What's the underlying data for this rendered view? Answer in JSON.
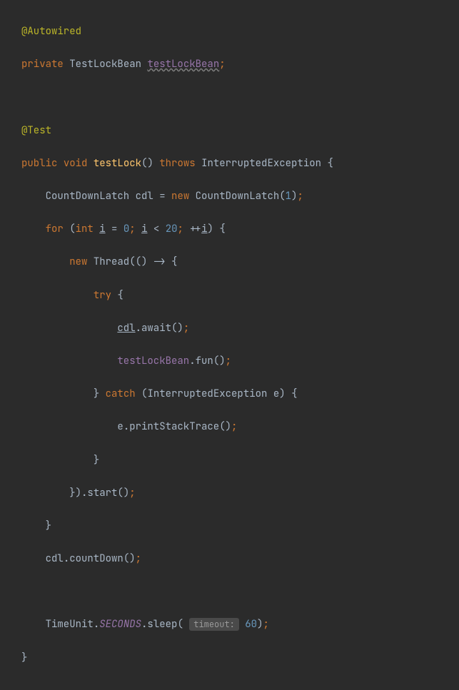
{
  "code": {
    "annotation_autowired": "@Autowired",
    "kw_private": "private",
    "type_testlockbean": "TestLockBean",
    "field_testlockbean": "testLockBean",
    "semi": ";",
    "annotation_test": "@Test",
    "kw_public": "public",
    "kw_void": "void",
    "method_testlock": "testLock",
    "kw_throws": "throws",
    "type_interruptedexception": "InterruptedException",
    "lbrace": "{",
    "rbrace": "}",
    "type_countdownlatch": "CountDownLatch",
    "var_cdl": "cdl",
    "op_assign": "=",
    "kw_new": "new",
    "num_1": "1",
    "kw_for": "for",
    "kw_int": "int",
    "var_i": "i",
    "num_0": "0",
    "op_lt": "<",
    "num_20": "20",
    "op_preinc": "++",
    "type_thread": "Thread",
    "lambda": "() ->",
    "kw_try": "try",
    "method_await": ".await",
    "method_fun": ".fun",
    "kw_catch": "catch",
    "var_e": "e",
    "method_printstacktrace": ".printStackTrace",
    "method_start": ".start",
    "method_countdown": ".countDown",
    "type_timeunit": "TimeUnit",
    "field_seconds": "SECONDS",
    "method_sleep": ".sleep",
    "hint_timeout": "timeout:",
    "num_60": "60",
    "lparen": "(",
    "rparen": ")",
    "dot": "."
  }
}
